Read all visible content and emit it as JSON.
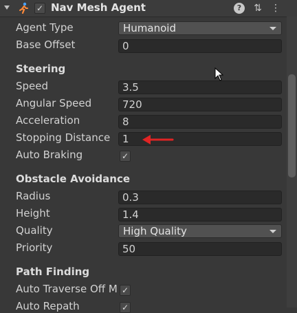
{
  "header": {
    "title": "Nav Mesh Agent",
    "enabled_check": "✓",
    "help_label": "?",
    "presets_glyph": "⇅",
    "menu_glyph": "⋮"
  },
  "fields": {
    "agent_type": {
      "label": "Agent Type",
      "value": "Humanoid"
    },
    "base_offset": {
      "label": "Base Offset",
      "value": "0"
    }
  },
  "steering": {
    "title": "Steering",
    "speed": {
      "label": "Speed",
      "value": "3.5"
    },
    "angular_speed": {
      "label": "Angular Speed",
      "value": "720"
    },
    "acceleration": {
      "label": "Acceleration",
      "value": "8"
    },
    "stopping_distance": {
      "label": "Stopping Distance",
      "value": "1"
    },
    "auto_braking": {
      "label": "Auto Braking",
      "check": "✓"
    }
  },
  "obstacle_avoidance": {
    "title": "Obstacle Avoidance",
    "radius": {
      "label": "Radius",
      "value": "0.3"
    },
    "height": {
      "label": "Height",
      "value": "1.4"
    },
    "quality": {
      "label": "Quality",
      "value": "High Quality"
    },
    "priority": {
      "label": "Priority",
      "value": "50"
    }
  },
  "path_finding": {
    "title": "Path Finding",
    "auto_traverse": {
      "label": "Auto Traverse Off M",
      "check": "✓"
    },
    "auto_repath": {
      "label": "Auto Repath",
      "check": "✓"
    }
  },
  "colors": {
    "accent_arrow": "#e02424",
    "background": "#383838"
  }
}
